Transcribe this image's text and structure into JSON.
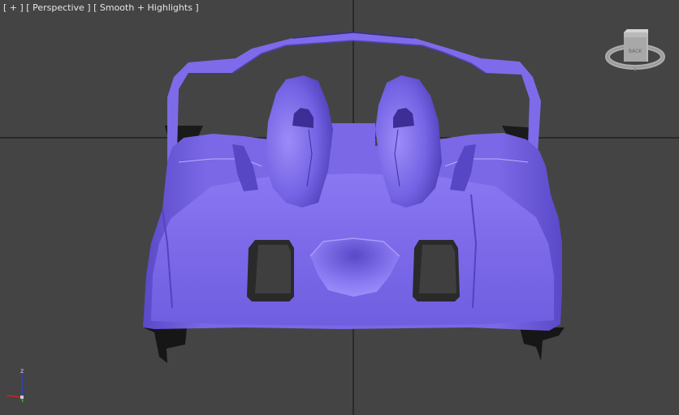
{
  "viewport": {
    "label_plus": "[ + ]",
    "label_view": "[ Perspective ]",
    "label_shading": "[ Smooth + Highlights ]",
    "background_color": "#444444",
    "grid_color": "#111111",
    "model_color": "#7b69e8"
  },
  "viewcube": {
    "face_label": "BACK",
    "icon": "viewcube-icon"
  },
  "axis_gizmo": {
    "z_label": "z",
    "x_color": "#d42020",
    "y_color": "#20c020",
    "z_color": "#2040e0"
  }
}
